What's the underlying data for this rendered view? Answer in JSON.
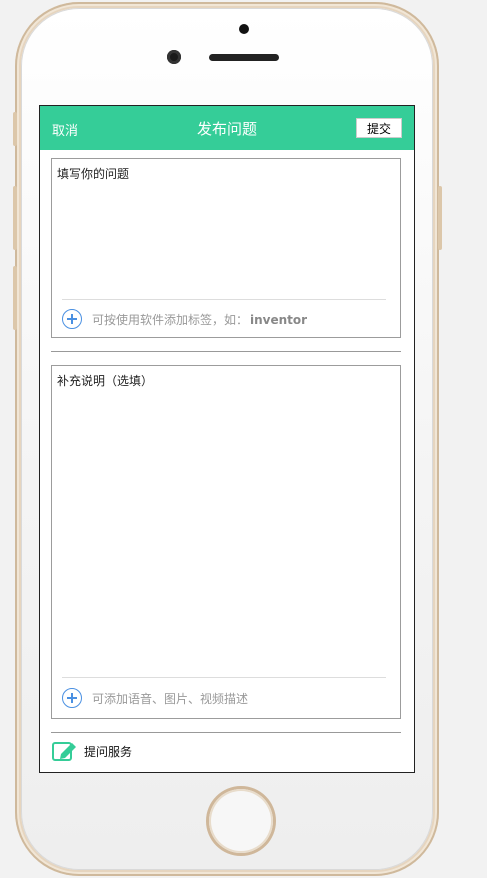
{
  "header": {
    "cancel_label": "取消",
    "title": "发布问题",
    "submit_label": "提交"
  },
  "question": {
    "placeholder": "填写你的问题",
    "tag_hint": "可按使用软件添加标签，如：",
    "tag_example": "inventor"
  },
  "details": {
    "placeholder": "补充说明（选填）",
    "media_hint": "可添加语音、图片、视频描述"
  },
  "footer": {
    "service_label": "提问服务"
  },
  "colors": {
    "accent": "#35cd98",
    "plus_icon": "#4a90e2"
  },
  "icons": {
    "add_tag": "plus-circle-icon",
    "add_media": "plus-circle-icon",
    "service": "edit-icon"
  }
}
